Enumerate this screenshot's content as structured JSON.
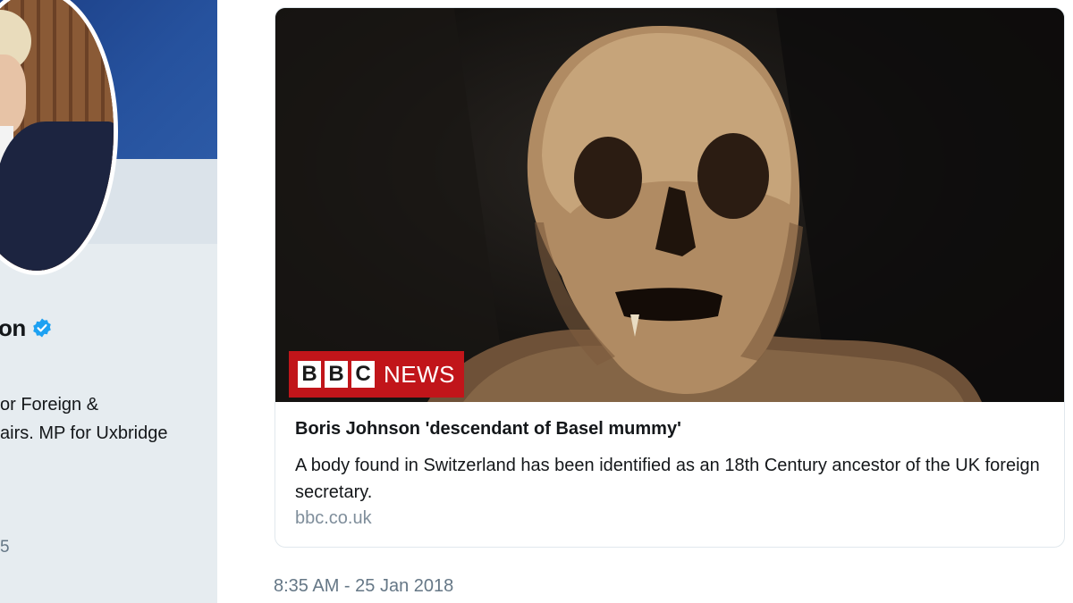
{
  "profile": {
    "name": "on",
    "bio_line1": "or Foreign &",
    "bio_line2": "airs. MP for Uxbridge",
    "stat_fragment": "5"
  },
  "card": {
    "logo_letters": [
      "B",
      "B",
      "C"
    ],
    "logo_word": "NEWS",
    "title": "Boris Johnson 'descendant of Basel mummy'",
    "description": "A body found in Switzerland has been identified as an 18th Century ancestor of the UK foreign secretary.",
    "domain": "bbc.co.uk"
  },
  "timestamp": "8:35 AM - 25 Jan 2018",
  "colors": {
    "verified": "#1da1f2",
    "bbc_red": "#c1151a",
    "text": "#14171a",
    "muted": "#657786"
  }
}
